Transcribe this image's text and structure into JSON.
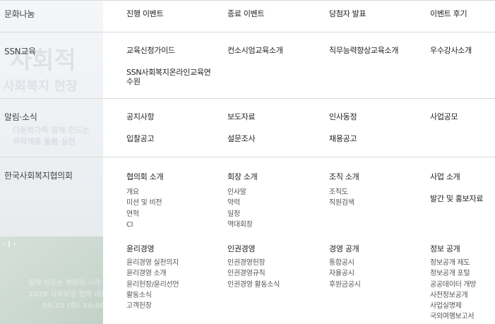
{
  "sections": [
    {
      "category": "문화나눔",
      "items": [
        "진행 이벤트",
        "종료 이벤트",
        "당첨자 발표",
        "이벤트 후기"
      ]
    },
    {
      "category": "SSN교육",
      "items": [
        "교육신청가이드",
        "컨소시엄교육소개",
        "직무능력향상교육소개",
        "우수강사소개",
        "SSN사회복지온라인교육연수원"
      ]
    },
    {
      "category": "알림·소식",
      "items": [
        "공지사항",
        "보도자료",
        "인사동정",
        "사업공모",
        "입찰공고",
        "설문조사",
        "채용공고"
      ]
    },
    {
      "category": "한국사회복지협의회",
      "groups": [
        {
          "title": "협의회 소개",
          "links": [
            "개요",
            "미션 및 비전",
            "연혁",
            "CI"
          ]
        },
        {
          "title": "회장 소개",
          "links": [
            "인사말",
            "약력",
            "일정",
            "역대회장"
          ]
        },
        {
          "title": "조직 소개",
          "links": [
            "조직도",
            "직원검색"
          ]
        },
        {
          "title": "사업 소개",
          "links": []
        },
        {
          "title": "발간 및 홍보자료",
          "links": []
        },
        {
          "title": "윤리경영",
          "links": [
            "윤리경영 실천의지",
            "윤리경영 소개",
            "윤리헌장/윤리선언",
            "활동소식",
            "고객헌장"
          ]
        },
        {
          "title": "인권경영",
          "links": [
            "인권경영헌장",
            "인권경영규칙",
            "인권경영 활동소식"
          ]
        },
        {
          "title": "경영 공개",
          "links": [
            "통합공시",
            "자율공시",
            "후원금공시"
          ]
        },
        {
          "title": "정보 공개",
          "links": [
            "정보공개 제도",
            "정보공개 포털",
            "공공데이터 개방",
            "사전정보공개",
            "사업실명제",
            "국외여행보고서"
          ]
        }
      ]
    }
  ],
  "background": {
    "ghost_lines": [
      "사회적",
      "사회복지 현장",
      "다문화가족 함께 만드는",
      "취약계층 돌봄 실천",
      "함께 만드는 변화의 시작",
      "2025 사회보장 협력 네트워크",
      "09.23 (화) 14:00"
    ],
    "slider_controls": [
      "‹",
      "‖",
      "›"
    ]
  }
}
